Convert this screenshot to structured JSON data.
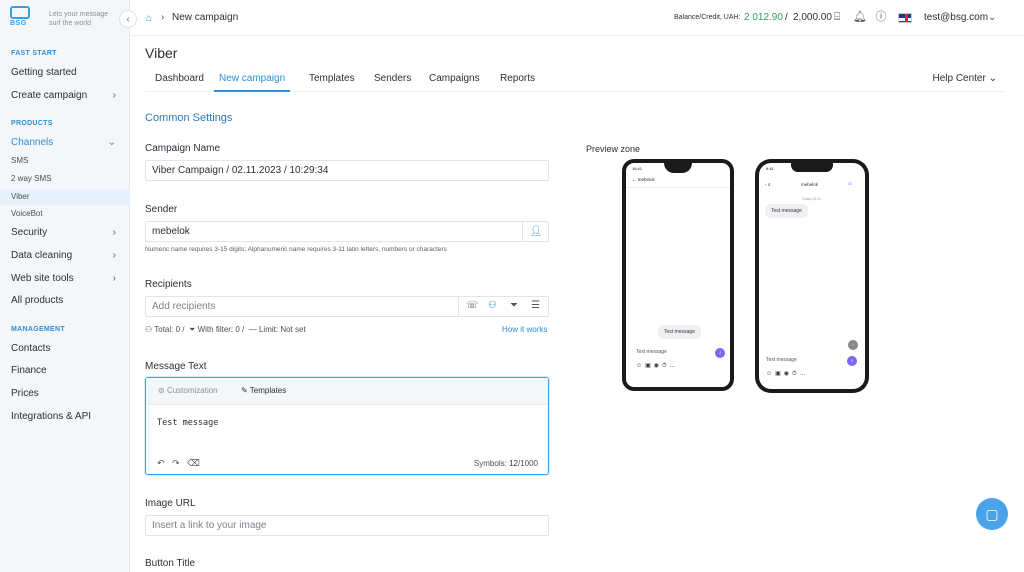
{
  "brand": {
    "logo_text": "BSG",
    "tagline": "Lets your message surf the world"
  },
  "sidebar": {
    "sections": {
      "fast_start": "FAST START",
      "products": "PRODUCTS",
      "management": "MANAGEMENT"
    },
    "items": {
      "getting_started": "Getting started",
      "create_campaign": "Create campaign",
      "channels": "Channels",
      "sms": "SMS",
      "two_way_sms": "2 way SMS",
      "viber": "Viber",
      "voicebot": "VoiceBot",
      "security": "Security",
      "data_cleaning": "Data cleaning",
      "web_site_tools": "Web site tools",
      "all_products": "All products",
      "contacts": "Contacts",
      "finance": "Finance",
      "prices": "Prices",
      "integrations": "Integrations & API"
    }
  },
  "topbar": {
    "breadcrumb_current": "New campaign",
    "balance_label": "Balance/Credit, UAH:",
    "balance_value": "2 012.90",
    "balance_separator": "/",
    "credit_value": "2,000.00",
    "user_email": "test@bsg.com"
  },
  "page": {
    "title": "Viber",
    "tabs": [
      "Dashboard",
      "New campaign",
      "Templates",
      "Senders",
      "Campaigns",
      "Reports"
    ],
    "help_center": "Help Center"
  },
  "form": {
    "section_title": "Common Settings",
    "campaign_name_label": "Campaign Name",
    "campaign_name_value": "Viber Campaign / 02.11.2023 / 10:29:34",
    "sender_label": "Sender",
    "sender_value": "mebelok",
    "sender_hint": "Numeric name requires 3-15 digits; Alphanumeric name requires 3-11 latin letters, numbers or characters",
    "recipients_label": "Recipients",
    "recipients_placeholder": "Add recipients",
    "stats_total": "Total: 0 /",
    "stats_filter": "With filter: 0 /",
    "stats_limit": "Limit: Not set",
    "how_it_works": "How it works",
    "message_label": "Message Text",
    "customization_tab": "Customization",
    "templates_tab": "Templates",
    "message_value": "Test message",
    "symbols_label": "Symbols:",
    "symbols_count": "12",
    "symbols_max": "/1000",
    "image_url_label": "Image URL",
    "image_url_placeholder": "Insert a link to your image",
    "button_title_label": "Button Title"
  },
  "preview": {
    "label": "Preview zone",
    "android": {
      "time": "16:41",
      "sender": "mebelok",
      "bubble": "Test message",
      "input": "Text message"
    },
    "iphone": {
      "time": "9:41",
      "sender": "mebelok",
      "date": "Today 13:11",
      "bubble": "Test message",
      "input": "Text message"
    }
  },
  "colors": {
    "accent": "#2d8fd5",
    "balance": "#2aa35c",
    "viber": "#7b68ee"
  }
}
